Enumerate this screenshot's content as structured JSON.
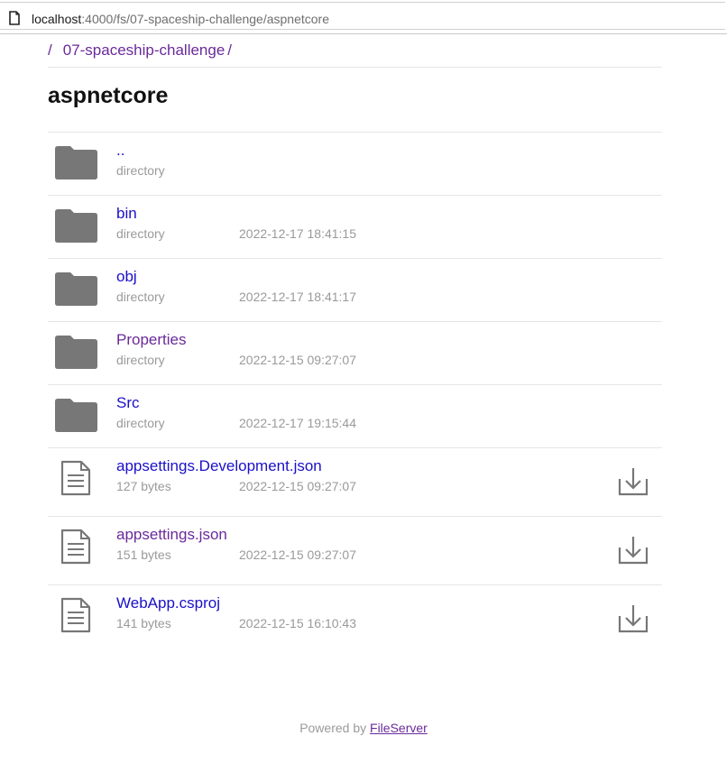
{
  "browser": {
    "url_host": "localhost",
    "url_path": ":4000/fs/07-spaceship-challenge/aspnetcore"
  },
  "breadcrumb": {
    "separator": "/",
    "items": [
      {
        "label": "07-spaceship-challenge"
      }
    ]
  },
  "page_title": "aspnetcore",
  "entries": [
    {
      "name": "..",
      "type": "directory",
      "meta": "directory",
      "date": "",
      "icon": "folder-icon",
      "visited": false
    },
    {
      "name": "bin",
      "type": "directory",
      "meta": "directory",
      "date": "2022-12-17 18:41:15",
      "icon": "folder-icon",
      "visited": false
    },
    {
      "name": "obj",
      "type": "directory",
      "meta": "directory",
      "date": "2022-12-17 18:41:17",
      "icon": "folder-icon",
      "visited": false
    },
    {
      "name": "Properties",
      "type": "directory",
      "meta": "directory",
      "date": "2022-12-15 09:27:07",
      "icon": "folder-icon",
      "visited": true
    },
    {
      "name": "Src",
      "type": "directory",
      "meta": "directory",
      "date": "2022-12-17 19:15:44",
      "icon": "folder-icon",
      "visited": false
    },
    {
      "name": "appsettings.Development.json",
      "type": "file",
      "meta": "127 bytes",
      "date": "2022-12-15 09:27:07",
      "icon": "file-icon",
      "visited": false
    },
    {
      "name": "appsettings.json",
      "type": "file",
      "meta": "151 bytes",
      "date": "2022-12-15 09:27:07",
      "icon": "file-icon",
      "visited": true
    },
    {
      "name": "WebApp.csproj",
      "type": "file",
      "meta": "141 bytes",
      "date": "2022-12-15 16:10:43",
      "icon": "file-icon",
      "visited": false
    }
  ],
  "footer": {
    "prefix": "Powered by",
    "link_label": "FileServer"
  },
  "colors": {
    "link": "#1a10c8",
    "visited_link": "#6a2a9a",
    "muted_text": "#9a9a9a",
    "icon_gray": "#777777"
  }
}
